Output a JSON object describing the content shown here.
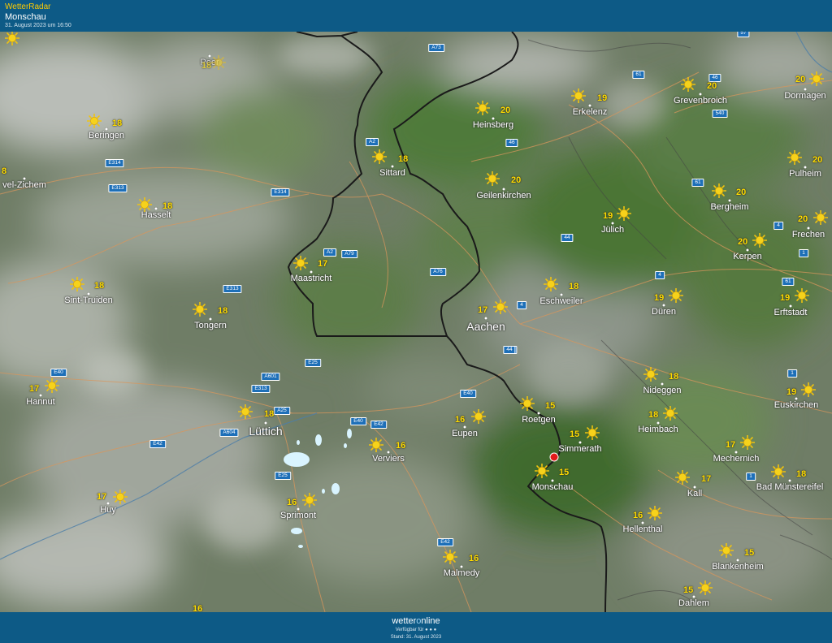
{
  "header": {
    "brand": "WetterRadar",
    "place": "Monschau",
    "date": "31. August 2023 um 16:50"
  },
  "footer": {
    "logo_a": "wetter",
    "logo_b": "o",
    "logo_c": "nline",
    "available": "Verfügbar für ● ● ●",
    "stand": "Stand: 31. August 2023"
  },
  "colors": {
    "header_bg": "#0d5a86",
    "temperature": "#ffdd00",
    "border": "#1a1a1a",
    "selected_pin": "#e11a1a"
  },
  "icons": {
    "weather": "sun-icon",
    "selected": "location-pin-icon"
  },
  "cities": [
    {
      "id": "peer",
      "name": "Peer",
      "temp": "18",
      "faded": true
    },
    {
      "id": "beringen",
      "name": "Beringen",
      "temp": "18"
    },
    {
      "id": "zichem",
      "name": "vel-Zichem",
      "temp": "8"
    },
    {
      "id": "hasselt",
      "name": "Hasselt",
      "temp": "18"
    },
    {
      "id": "sint-truiden",
      "name": "Sint-Truiden",
      "temp": "18"
    },
    {
      "id": "tongern",
      "name": "Tongern",
      "temp": "18"
    },
    {
      "id": "hannut",
      "name": "Hannut",
      "temp": "17"
    },
    {
      "id": "huy",
      "name": "Huy",
      "temp": "17"
    },
    {
      "id": "luettich",
      "name": "Lüttich",
      "temp": "18",
      "big": true
    },
    {
      "id": "sprimont",
      "name": "Sprimont",
      "temp": "16"
    },
    {
      "id": "verviers",
      "name": "Verviers",
      "temp": "16"
    },
    {
      "id": "malmedy",
      "name": "Malmedy",
      "temp": "16"
    },
    {
      "id": "eupen",
      "name": "Eupen",
      "temp": "16"
    },
    {
      "id": "maastricht",
      "name": "Maastricht",
      "temp": "17"
    },
    {
      "id": "sittard",
      "name": "Sittard",
      "temp": "18"
    },
    {
      "id": "heinsberg",
      "name": "Heinsberg",
      "temp": "20"
    },
    {
      "id": "geilenkirchen",
      "name": "Geilenkirchen",
      "temp": "20"
    },
    {
      "id": "erkelenz",
      "name": "Erkelenz",
      "temp": "19"
    },
    {
      "id": "aachen",
      "name": "Aachen",
      "temp": "17",
      "big": true
    },
    {
      "id": "eschweiler",
      "name": "Eschweiler",
      "temp": "18"
    },
    {
      "id": "juelich",
      "name": "Jülich",
      "temp": "19"
    },
    {
      "id": "dueren",
      "name": "Düren",
      "temp": "19"
    },
    {
      "id": "roetgen",
      "name": "Roetgen",
      "temp": "15"
    },
    {
      "id": "simmerath",
      "name": "Simmerath",
      "temp": "15"
    },
    {
      "id": "monschau",
      "name": "Monschau",
      "temp": "15"
    },
    {
      "id": "nideggen",
      "name": "Nideggen",
      "temp": "18"
    },
    {
      "id": "heimbach",
      "name": "Heimbach",
      "temp": "18"
    },
    {
      "id": "hellenthal",
      "name": "Hellenthal",
      "temp": "16"
    },
    {
      "id": "kall",
      "name": "Kall",
      "temp": "17"
    },
    {
      "id": "mechernich",
      "name": "Mechernich",
      "temp": "17"
    },
    {
      "id": "bad-muenstereifel",
      "name": "Bad Münstereifel",
      "temp": "18"
    },
    {
      "id": "euskirchen",
      "name": "Euskirchen",
      "temp": "19"
    },
    {
      "id": "blankenheim",
      "name": "Blankenheim",
      "temp": "15"
    },
    {
      "id": "dahlem",
      "name": "Dahlem",
      "temp": "15"
    },
    {
      "id": "erftstadt",
      "name": "Erftstadt",
      "temp": "19"
    },
    {
      "id": "kerpen",
      "name": "Kerpen",
      "temp": "20"
    },
    {
      "id": "bergheim",
      "name": "Bergheim",
      "temp": "20"
    },
    {
      "id": "frechen",
      "name": "Frechen",
      "temp": "20"
    },
    {
      "id": "pulheim",
      "name": "Pulheim",
      "temp": "20"
    },
    {
      "id": "dormagen",
      "name": "Dormagen",
      "temp": "20"
    },
    {
      "id": "grevenbroich",
      "name": "Grevenbroich",
      "temp": "20"
    }
  ],
  "extra_temps": [
    {
      "id": "corner-top-left",
      "temp": ""
    },
    {
      "id": "bottom-partial",
      "temp": "16"
    }
  ],
  "roads": [
    "A73",
    "A2",
    "E314",
    "E313",
    "E314",
    "A2",
    "A79",
    "A76",
    "E313",
    "E25",
    "A601",
    "E40",
    "E313",
    "A25",
    "A604",
    "E42",
    "E40",
    "E42",
    "E25",
    "E40",
    "E42",
    "44",
    "4",
    "44",
    "46",
    "61",
    "57",
    "46",
    "540",
    "61",
    "4",
    "1",
    "61",
    "44",
    "4",
    "1",
    "1"
  ]
}
